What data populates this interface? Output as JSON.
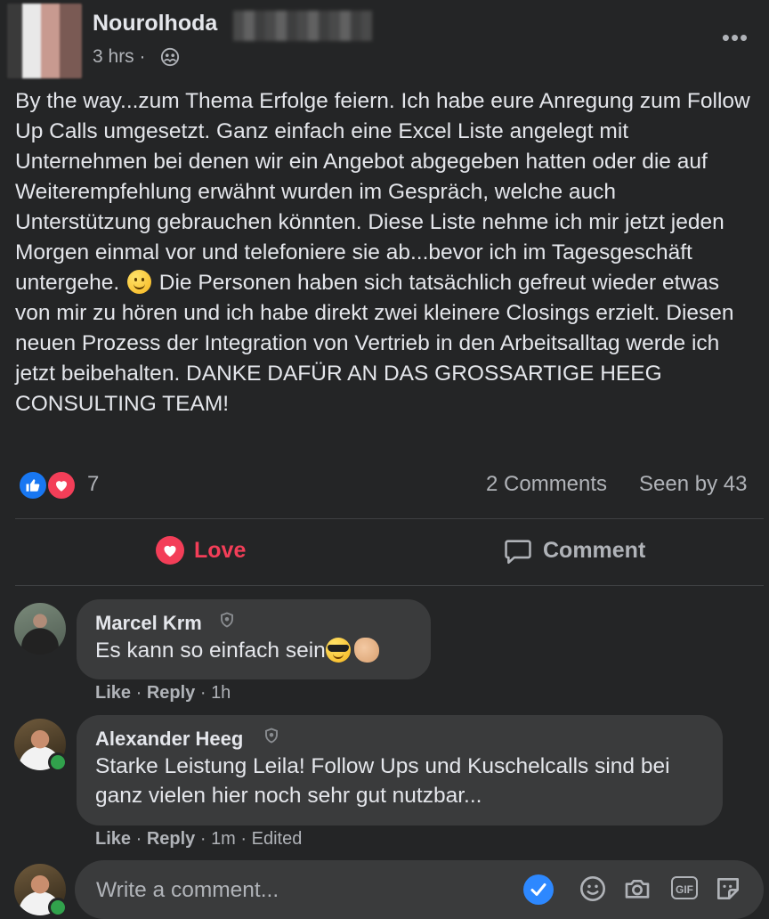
{
  "post": {
    "author": "Nourolhoda",
    "time": "3 hrs",
    "time_separator": "·",
    "audience_icon": "group-icon",
    "more_icon": "more-icon",
    "more_label": "•••",
    "text_part1": "By the way...zum Thema Erfolge feiern. Ich habe eure Anregung zum Follow Up Calls umgesetzt. Ganz einfach eine Excel Liste angelegt mit Unternehmen bei denen wir ein Angebot abgegeben hatten oder die auf Weiterempfehlung erwähnt wurden im Gespräch, welche auch Unterstützung gebrauchen könnten. Diese Liste nehme ich mir jetzt jeden Morgen einmal vor und telefoniere sie ab...bevor ich im Tagesgeschäft untergehe.",
    "text_emoji": "slightly-smiling-face",
    "text_part2": " Die Personen haben sich tatsächlich gefreut wieder etwas von mir zu hören und ich habe direkt zwei kleinere Closings erzielt. Diesen neuen Prozess der Integration von Vertrieb in den Arbeitsalltag werde ich jetzt beibehalten. DANKE DAFÜR AN DAS GROSSARTIGE HEEG CONSULTING TEAM!"
  },
  "stats": {
    "reaction_count": "7",
    "comments_count": "2 Comments",
    "seen_by": "Seen by 43"
  },
  "actions": {
    "love_label": "Love",
    "comment_label": "Comment"
  },
  "comments": [
    {
      "author": "Marcel Krm",
      "text": "Es kann so einfach sein",
      "like": "Like",
      "reply": "Reply",
      "time": "1h",
      "edited": ""
    },
    {
      "author": "Alexander Heeg",
      "text": "Starke Leistung Leila! Follow Ups und Kuschelcalls sind bei ganz vielen hier noch sehr gut nutzbar...",
      "like": "Like",
      "reply": "Reply",
      "time": "1m",
      "edited": "Edited"
    }
  ],
  "composer": {
    "placeholder": "Write a comment...",
    "gif_label": "GIF"
  },
  "colors": {
    "background": "#242526",
    "bubble": "#3a3b3c",
    "love": "#f33e58",
    "like": "#1877f2",
    "online": "#31a24c",
    "text": "#e4e6eb",
    "secondary_text": "#b0b3b8"
  }
}
